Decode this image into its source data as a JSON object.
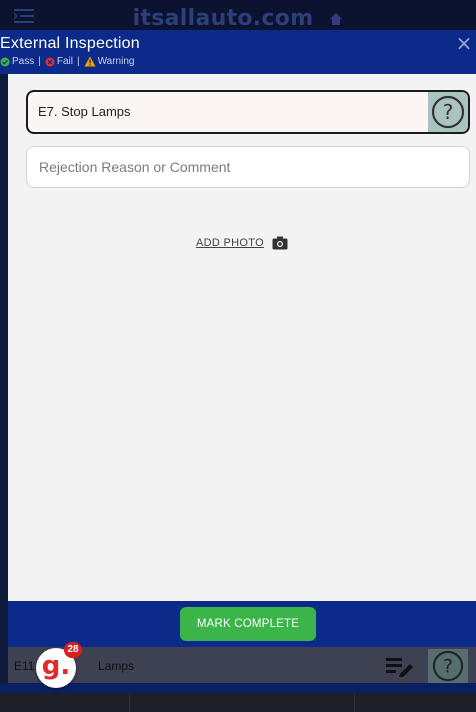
{
  "topbar": {
    "brand": "itsallauto.com"
  },
  "modal": {
    "title": "External Inspection",
    "legend": {
      "pass": "Pass",
      "fail": "Fail",
      "warning": "Warning",
      "separator": "|"
    },
    "close_label": "×",
    "item": {
      "title": "E7. Stop Lamps",
      "help_label": "?"
    },
    "comment": {
      "placeholder": "Rejection Reason or Comment",
      "value": ""
    },
    "add_photo_label": "ADD PHOTO",
    "mark_complete_label": "MARK COMPLETE"
  },
  "background_row": {
    "prefix": "E11",
    "suffix": "Lamps"
  },
  "badge": {
    "letter": "g.",
    "count": "28"
  },
  "colors": {
    "header": "#0c2a8a",
    "pass": "#3bb54a",
    "fail": "#e0302a",
    "warning": "#f0a500",
    "mark_complete": "#3bb54a",
    "help_button": "#a8c3c0"
  }
}
